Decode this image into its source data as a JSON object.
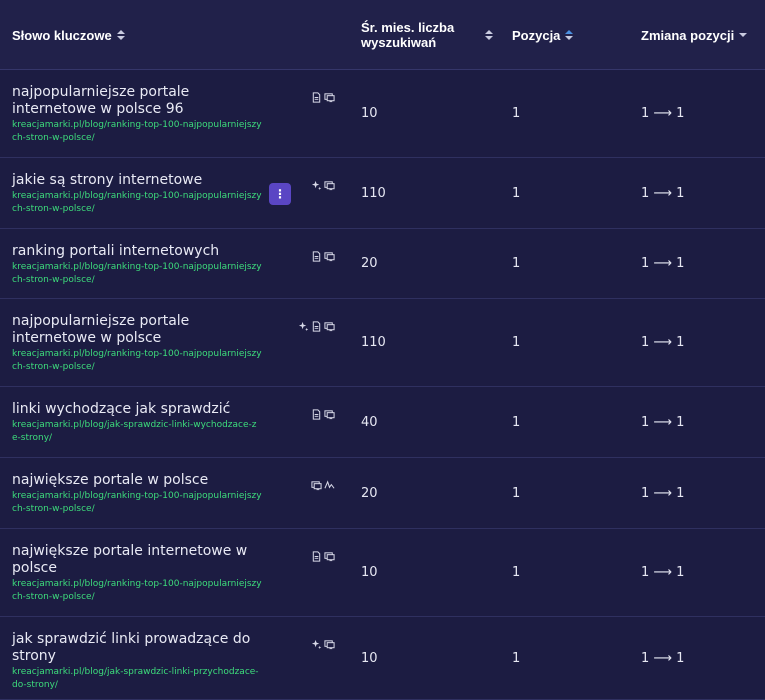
{
  "header": {
    "keyword_label": "Słowo kluczowe",
    "volume_label_line1": "Śr. mies. liczba",
    "volume_label_line2": "wyszukiwań",
    "position_label": "Pozycja",
    "change_label": "Zmiana pozycji"
  },
  "rows": [
    {
      "keyword": "najpopularniejsze portale internetowe w polsce 96",
      "url": "kreacjamarki.pl/blog/ranking-top-100-najpopularniejszych-stron-w-polsce/",
      "volume": "10",
      "position": "1",
      "change": "1 ⟶ 1",
      "icons": [
        "document-icon",
        "serp-icon"
      ]
    },
    {
      "keyword": "jakie są strony internetowe",
      "url": "kreacjamarki.pl/blog/ranking-top-100-najpopularniejszych-stron-w-polsce/",
      "volume": "110",
      "position": "1",
      "change": "1 ⟶ 1",
      "icons": [
        "sparkle-icon",
        "serp-icon"
      ],
      "menu": "⋮"
    },
    {
      "keyword": "ranking portali internetowych",
      "url": "kreacjamarki.pl/blog/ranking-top-100-najpopularniejszych-stron-w-polsce/",
      "volume": "20",
      "position": "1",
      "change": "1 ⟶ 1",
      "icons": [
        "document-icon",
        "serp-icon"
      ]
    },
    {
      "keyword": "najpopularniejsze portale internetowe w polsce",
      "url": "kreacjamarki.pl/blog/ranking-top-100-najpopularniejszych-stron-w-polsce/",
      "volume": "110",
      "position": "1",
      "change": "1 ⟶ 1",
      "icons": [
        "sparkle-icon",
        "document-icon",
        "serp-icon"
      ]
    },
    {
      "keyword": "linki wychodzące jak sprawdzić",
      "url": "kreacjamarki.pl/blog/jak-sprawdzic-linki-wychodzace-ze-strony/",
      "volume": "40",
      "position": "1",
      "change": "1 ⟶ 1",
      "icons": [
        "document-icon",
        "serp-icon"
      ]
    },
    {
      "keyword": "największe portale w polsce",
      "url": "kreacjamarki.pl/blog/ranking-top-100-najpopularniejszych-stron-w-polsce/",
      "volume": "20",
      "position": "1",
      "change": "1 ⟶ 1",
      "icons": [
        "serp-icon",
        "signature-icon"
      ]
    },
    {
      "keyword": "największe portale internetowe w polsce",
      "url": "kreacjamarki.pl/blog/ranking-top-100-najpopularniejszych-stron-w-polsce/",
      "volume": "10",
      "position": "1",
      "change": "1 ⟶ 1",
      "icons": [
        "document-icon",
        "serp-icon"
      ]
    },
    {
      "keyword": "jak sprawdzić linki prowadzące do strony",
      "url": "kreacjamarki.pl/blog/jak-sprawdzic-linki-przychodzace-do-strony/",
      "volume": "10",
      "position": "1",
      "change": "1 ⟶ 1",
      "icons": [
        "sparkle-icon",
        "serp-icon"
      ]
    }
  ]
}
